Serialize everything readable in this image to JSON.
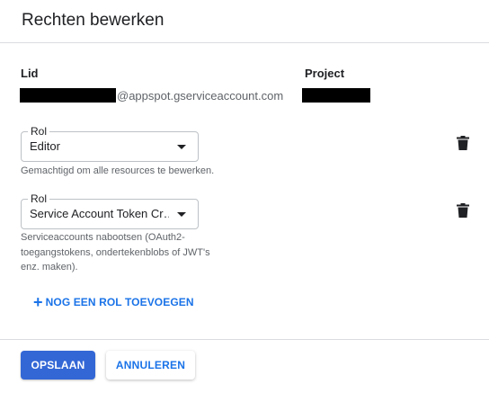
{
  "dialog": {
    "title": "Rechten bewerken"
  },
  "member": {
    "header": "Lid",
    "domain_suffix": "@appspot.gserviceaccount.com"
  },
  "project": {
    "header": "Project"
  },
  "roles": [
    {
      "label": "Rol",
      "value": "Editor",
      "helper": "Gemachtigd om alle resources te bewerken."
    },
    {
      "label": "Rol",
      "value": "Service Account Token Cr…",
      "helper_lines": [
        "Serviceaccounts nabootsen (OAuth2-",
        "toegangstokens, ondertekenblobs of JWT's",
        "enz. maken)."
      ]
    }
  ],
  "add_role_label": "NOG EEN ROL TOEVOEGEN",
  "buttons": {
    "save": "OPSLAAN",
    "cancel": "ANNULEREN"
  },
  "colors": {
    "primary": "#3367d6",
    "link": "#1a73e8",
    "redaction": "#000000"
  },
  "icons": {
    "delete": "trash-icon",
    "add": "plus-icon",
    "dropdown": "triangle-down-icon"
  }
}
